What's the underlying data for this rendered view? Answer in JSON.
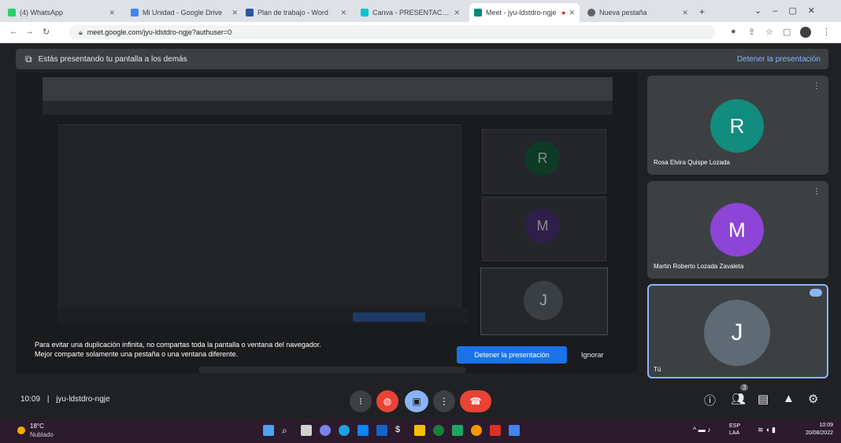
{
  "browser": {
    "tabs": [
      {
        "label": "(4) WhatsApp",
        "favicon": "#25d366"
      },
      {
        "label": "Mi Unidad - Google Drive",
        "favicon": "#4285f4"
      },
      {
        "label": "Plan de trabajo - Word",
        "favicon": "#2b579a"
      },
      {
        "label": "Canva - PRESENTACIÓN",
        "favicon": "#00c4cc"
      },
      {
        "label": "Meet - jyu-ldstdro-ngje",
        "favicon": "#00897b"
      },
      {
        "label": "Nueva pestaña",
        "favicon": "#5f6368"
      }
    ],
    "url": "meet.google.com/jyu-ldstdro-ngje?authuser=0"
  },
  "meet": {
    "presenting_bar": {
      "text": "Estás presentando tu pantalla a los demás",
      "stop_link": "Detener la presentación"
    },
    "warning": {
      "text": "Para evitar una duplicación infinita, no compartas toda la pantalla o ventana del navegador. Mejor comparte solamente una pestaña o una ventana diferente.",
      "stop_button": "Detener la presentación",
      "ignore": "Ignorar"
    },
    "stage_tiles": [
      {
        "initial": "R",
        "color": "#0b8043"
      },
      {
        "initial": "M",
        "color": "#7b3fc2"
      },
      {
        "initial": "J",
        "color": "#5f6b74"
      }
    ],
    "participants": [
      {
        "initial": "R",
        "name": "Rosa Elvira Quispe Lozada",
        "color": "#128c7e"
      },
      {
        "initial": "M",
        "name": "Martin Roberto Lozada Zavaleta",
        "color": "#8e44d6"
      },
      {
        "initial": "J",
        "name": "Tú",
        "color": "#5f6b74"
      }
    ],
    "meeting_info": {
      "time": "10:09",
      "separator": "|",
      "code": "jyu-ldstdro-ngje"
    },
    "participant_count": "3"
  },
  "taskbar": {
    "weather_temp": "18°C",
    "weather_desc": "Nublado",
    "language": "ESP LAA",
    "time": "10:09",
    "date": "20/08/2022"
  }
}
